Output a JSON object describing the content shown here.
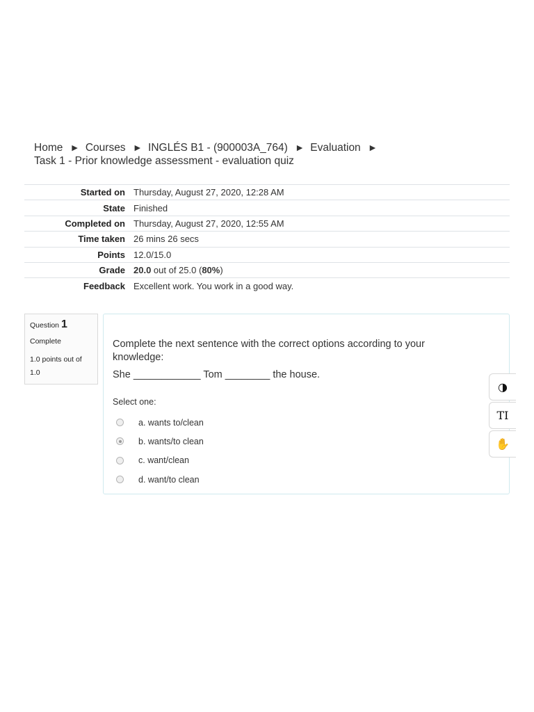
{
  "breadcrumb": {
    "items": [
      "Home",
      "Courses",
      "INGLÉS B1 - (900003A_764)",
      "Evaluation",
      "Task 1 - Prior knowledge assessment - evaluation quiz"
    ],
    "separator": "►"
  },
  "summary": {
    "started_on_label": "Started on",
    "started_on": "Thursday, August 27, 2020, 12:28 AM",
    "state_label": "State",
    "state": "Finished",
    "completed_on_label": "Completed on",
    "completed_on": "Thursday, August 27, 2020, 12:55 AM",
    "time_taken_label": "Time taken",
    "time_taken": "26 mins 26 secs",
    "points_label": "Points",
    "points": "12.0/15.0",
    "grade_label": "Grade",
    "grade_value": "20.0",
    "grade_mid": " out of 25.0 (",
    "grade_percent": "80%",
    "grade_end": ")",
    "feedback_label": "Feedback",
    "feedback": "Excellent work. You work in a good way."
  },
  "question": {
    "label": "Question",
    "number": "1",
    "state": "Complete",
    "grade": "1.0 points out of 1.0",
    "text": "Complete the next sentence with the correct options according to your knowledge:",
    "sentence": "She ____________ Tom ________ the house.",
    "prompt": "Select one:",
    "options": [
      {
        "label": "a. wants to/clean",
        "checked": false
      },
      {
        "label": "b. wants/to clean",
        "checked": true
      },
      {
        "label": "c. want/clean",
        "checked": false
      },
      {
        "label": "d. want/to clean",
        "checked": false
      }
    ]
  },
  "toolbar": {
    "contrast_icon": "◑",
    "font_icon": "TI",
    "sign_icon": "✋"
  }
}
